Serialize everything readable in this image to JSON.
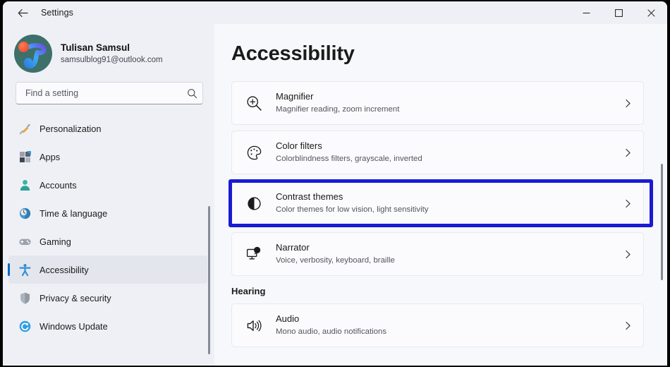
{
  "window": {
    "title": "Settings",
    "back_icon": "back-arrow-icon",
    "minimize_label": "─",
    "maximize_label": "□",
    "close_label": "✕"
  },
  "sidebar": {
    "profile": {
      "name": "Tulisan Samsul",
      "email": "samsulblog91@outlook.com",
      "avatar_icon": "user-avatar"
    },
    "search": {
      "placeholder": "Find a setting",
      "value": "",
      "icon": "search-icon"
    },
    "items": [
      {
        "label": "Personalization",
        "icon": "paintbrush-icon",
        "selected": false
      },
      {
        "label": "Apps",
        "icon": "apps-grid-icon",
        "selected": false
      },
      {
        "label": "Accounts",
        "icon": "person-icon",
        "selected": false
      },
      {
        "label": "Time & language",
        "icon": "clock-globe-icon",
        "selected": false
      },
      {
        "label": "Gaming",
        "icon": "gamepad-icon",
        "selected": false
      },
      {
        "label": "Accessibility",
        "icon": "accessibility-icon",
        "selected": true
      },
      {
        "label": "Privacy & security",
        "icon": "shield-icon",
        "selected": false
      },
      {
        "label": "Windows Update",
        "icon": "update-refresh-icon",
        "selected": false
      }
    ]
  },
  "main": {
    "page_title": "Accessibility",
    "vision_cards": [
      {
        "title": "Magnifier",
        "subtitle": "Magnifier reading, zoom increment",
        "icon": "magnifier-icon",
        "chevron": "chevron-right-icon",
        "highlighted": false
      },
      {
        "title": "Color filters",
        "subtitle": "Colorblindness filters, grayscale, inverted",
        "icon": "color-palette-icon",
        "chevron": "chevron-right-icon",
        "highlighted": false
      },
      {
        "title": "Contrast themes",
        "subtitle": "Color themes for low vision, light sensitivity",
        "icon": "contrast-circle-icon",
        "chevron": "chevron-right-icon",
        "highlighted": true
      },
      {
        "title": "Narrator",
        "subtitle": "Voice, verbosity, keyboard, braille",
        "icon": "narrator-monitor-icon",
        "chevron": "chevron-right-icon",
        "highlighted": false
      }
    ],
    "hearing_heading": "Hearing",
    "hearing_cards": [
      {
        "title": "Audio",
        "subtitle": "Mono audio, audio notifications",
        "icon": "speaker-icon",
        "chevron": "chevron-right-icon",
        "highlighted": false
      }
    ]
  },
  "colors": {
    "highlight_border": "#1a1ad2",
    "selection_pill": "#0067c0",
    "sidebar_bg": "#eef0f5",
    "content_bg": "#f7f8fb",
    "card_bg": "#fbfbfd"
  }
}
